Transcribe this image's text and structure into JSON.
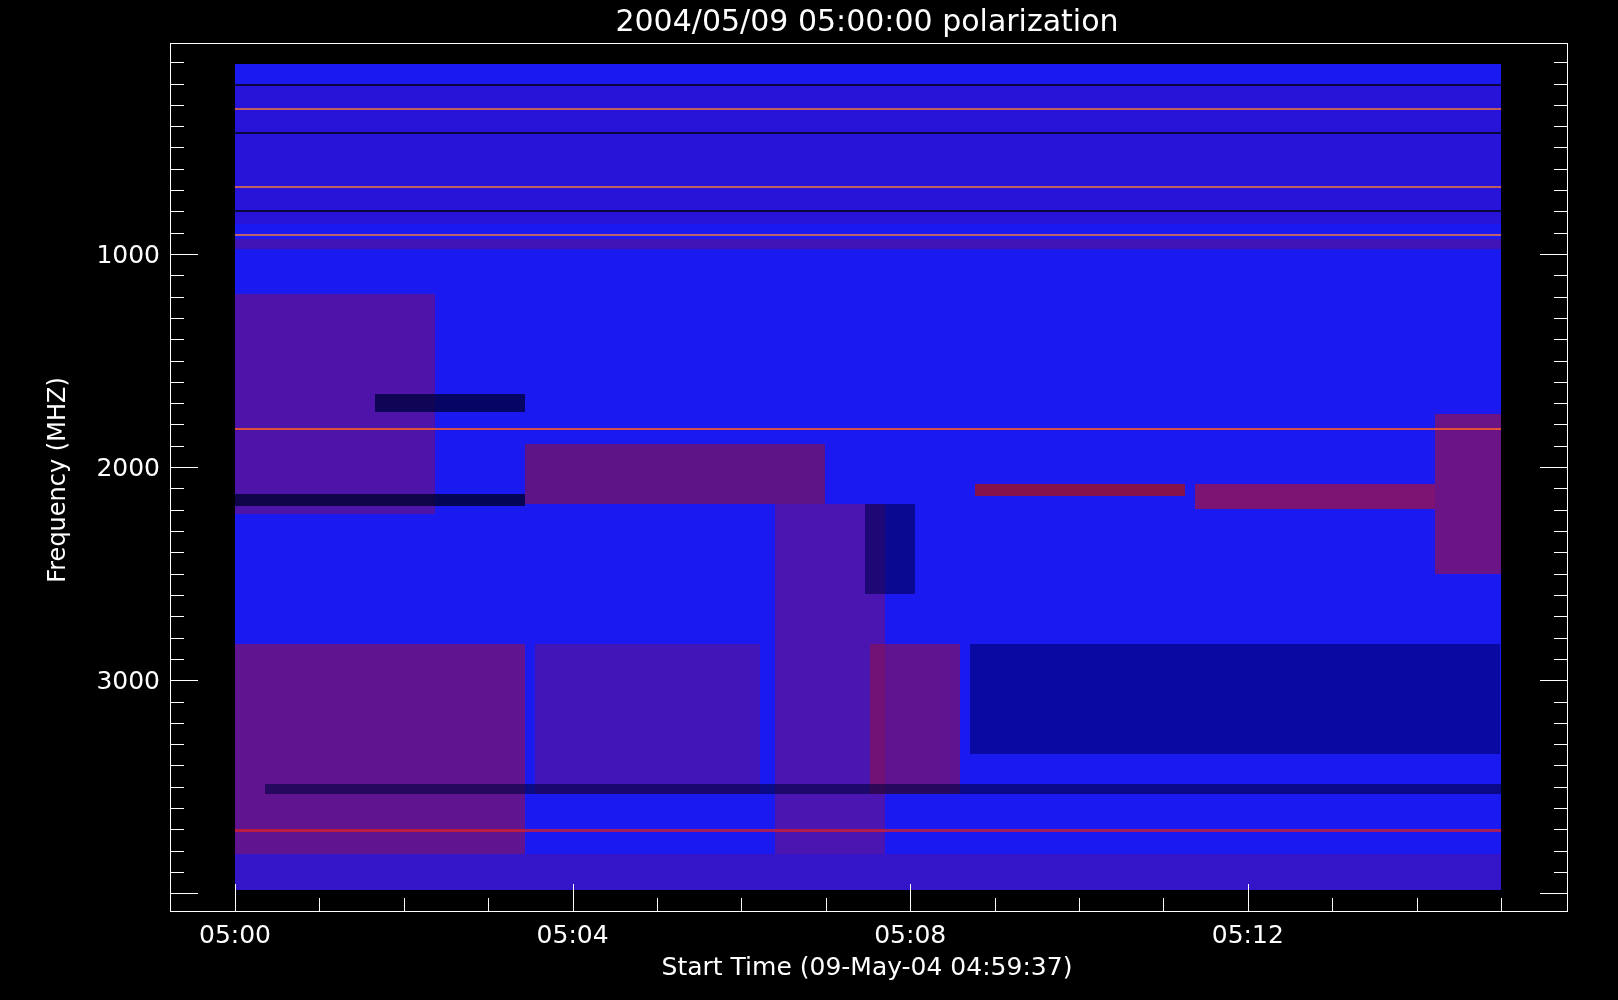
{
  "plot": {
    "title": "2004/05/09 05:00:00 polarization",
    "xlabel": "Start Time (09-May-04 04:59:37)",
    "ylabel": "Frequency (MHZ)",
    "xticks": [
      "05:00",
      "05:04",
      "05:08",
      "05:12"
    ],
    "yticks": [
      "1000",
      "2000",
      "3000"
    ]
  }
}
